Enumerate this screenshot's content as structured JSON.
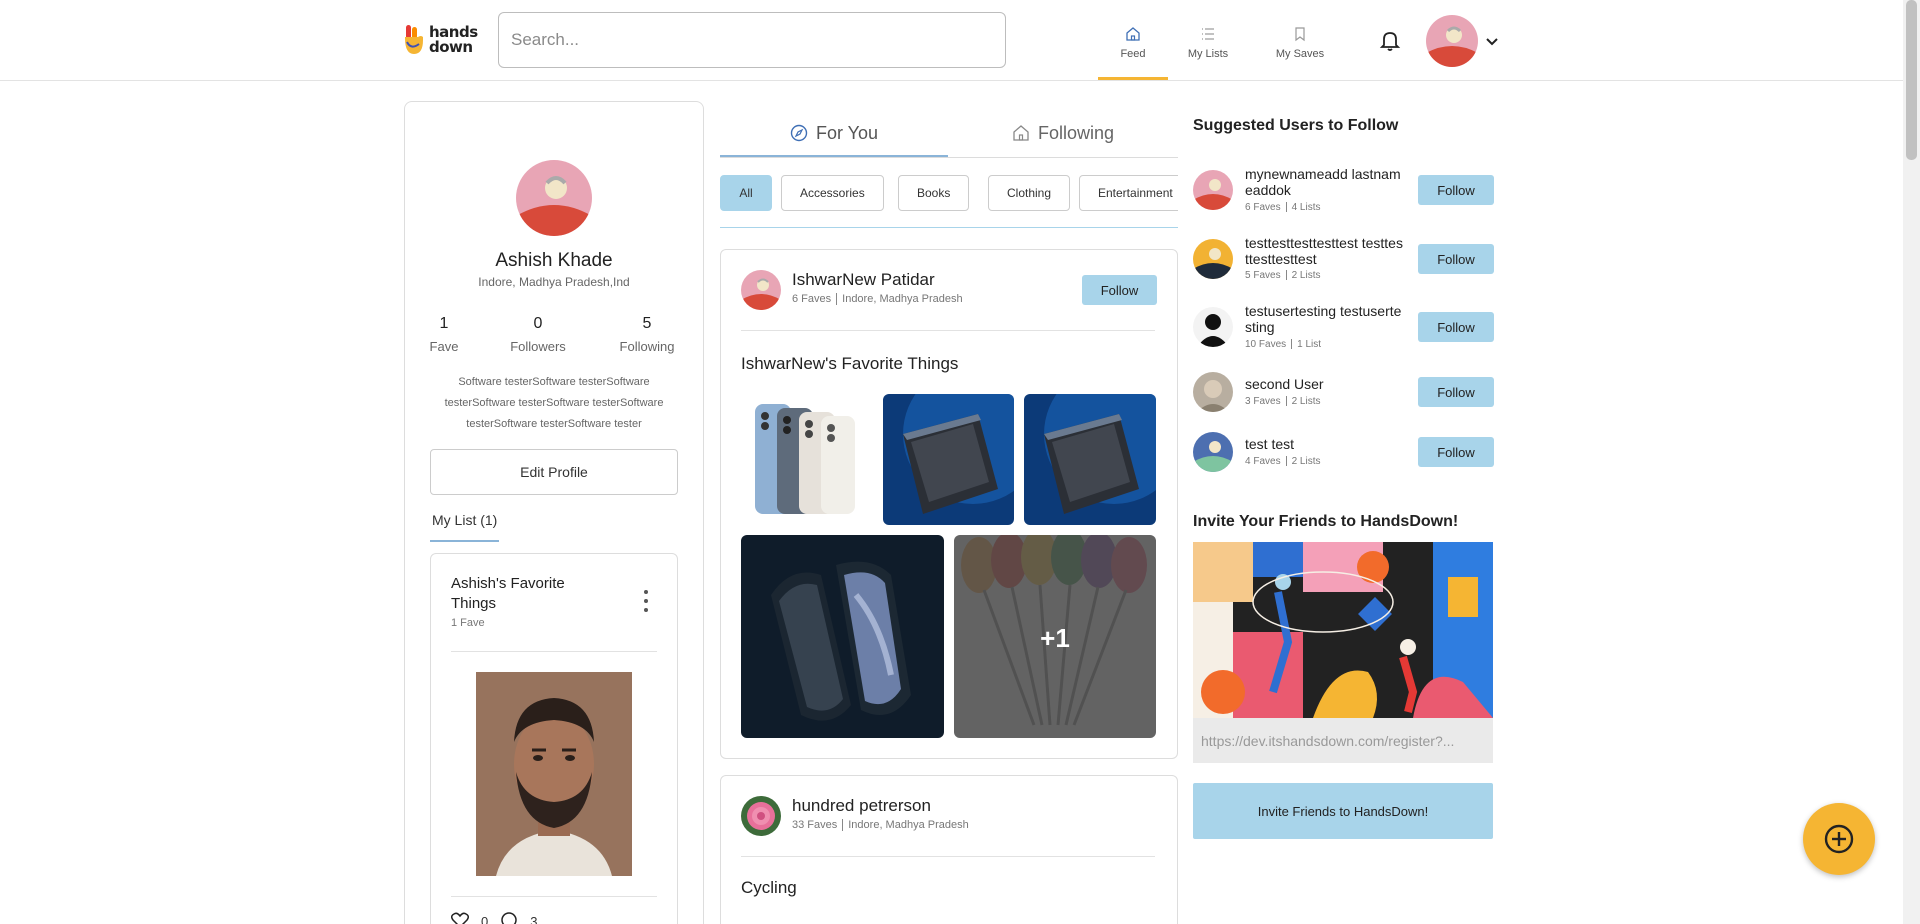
{
  "header": {
    "logo_text_1": "hands",
    "logo_text_2": "down",
    "search_placeholder": "Search...",
    "nav": [
      {
        "label": "Feed",
        "icon": "home-icon",
        "active": true
      },
      {
        "label": "My Lists",
        "icon": "list-icon",
        "active": false
      },
      {
        "label": "My Saves",
        "icon": "bookmark-icon",
        "active": false
      }
    ],
    "accent": "#f5b533"
  },
  "profile": {
    "name": "Ashish Khade",
    "location": "Indore, Madhya Pradesh,Ind",
    "stats": [
      {
        "value": "1",
        "label": "Fave"
      },
      {
        "value": "0",
        "label": "Followers"
      },
      {
        "value": "5",
        "label": "Following"
      }
    ],
    "bio": "Software testerSoftware testerSoftware testerSoftware testerSoftware testerSoftware testerSoftware testerSoftware tester",
    "edit_label": "Edit Profile",
    "list_tab": "My List (1)",
    "list_card": {
      "title": "Ashish's Favorite Things",
      "faves": "1 Fave",
      "likes": "0",
      "comments": "3"
    }
  },
  "feed": {
    "tabs": [
      {
        "label": "For You",
        "icon": "compass-icon",
        "active": true
      },
      {
        "label": "Following",
        "icon": "home-icon",
        "active": false
      }
    ],
    "chips": [
      "All",
      "Accessories",
      "Books",
      "Clothing",
      "Entertainment"
    ],
    "posts": [
      {
        "user": "IshwarNew Patidar",
        "faves": "6 Faves",
        "location": "Indore, Madhya Pradesh",
        "follow_label": "Follow",
        "title": "IshwarNew's Favorite Things",
        "more_count": "+1"
      },
      {
        "user": "hundred petrerson",
        "faves": "33 Faves",
        "location": "Indore, Madhya Pradesh",
        "title": "Cycling"
      }
    ]
  },
  "suggested": {
    "title": "Suggested Users to Follow",
    "users": [
      {
        "name": "mynewnameadd lastnameaddok",
        "faves": "6 Faves",
        "lists": "4 Lists",
        "follow": "Follow"
      },
      {
        "name": "testtesttesttesttest testtesttesttesttest",
        "faves": "5 Faves",
        "lists": "2 Lists",
        "follow": "Follow"
      },
      {
        "name": "testusertesting testusertesting",
        "faves": "10 Faves",
        "lists": "1 List",
        "follow": "Follow"
      },
      {
        "name": "second User",
        "faves": "3 Faves",
        "lists": "2 Lists",
        "follow": "Follow"
      },
      {
        "name": "test test",
        "faves": "4 Faves",
        "lists": "2 Lists",
        "follow": "Follow"
      }
    ]
  },
  "invite": {
    "title": "Invite Your Friends to HandsDown!",
    "url": "https://dev.itshandsdown.com/register?...",
    "button": "Invite Friends to HandsDown!"
  }
}
